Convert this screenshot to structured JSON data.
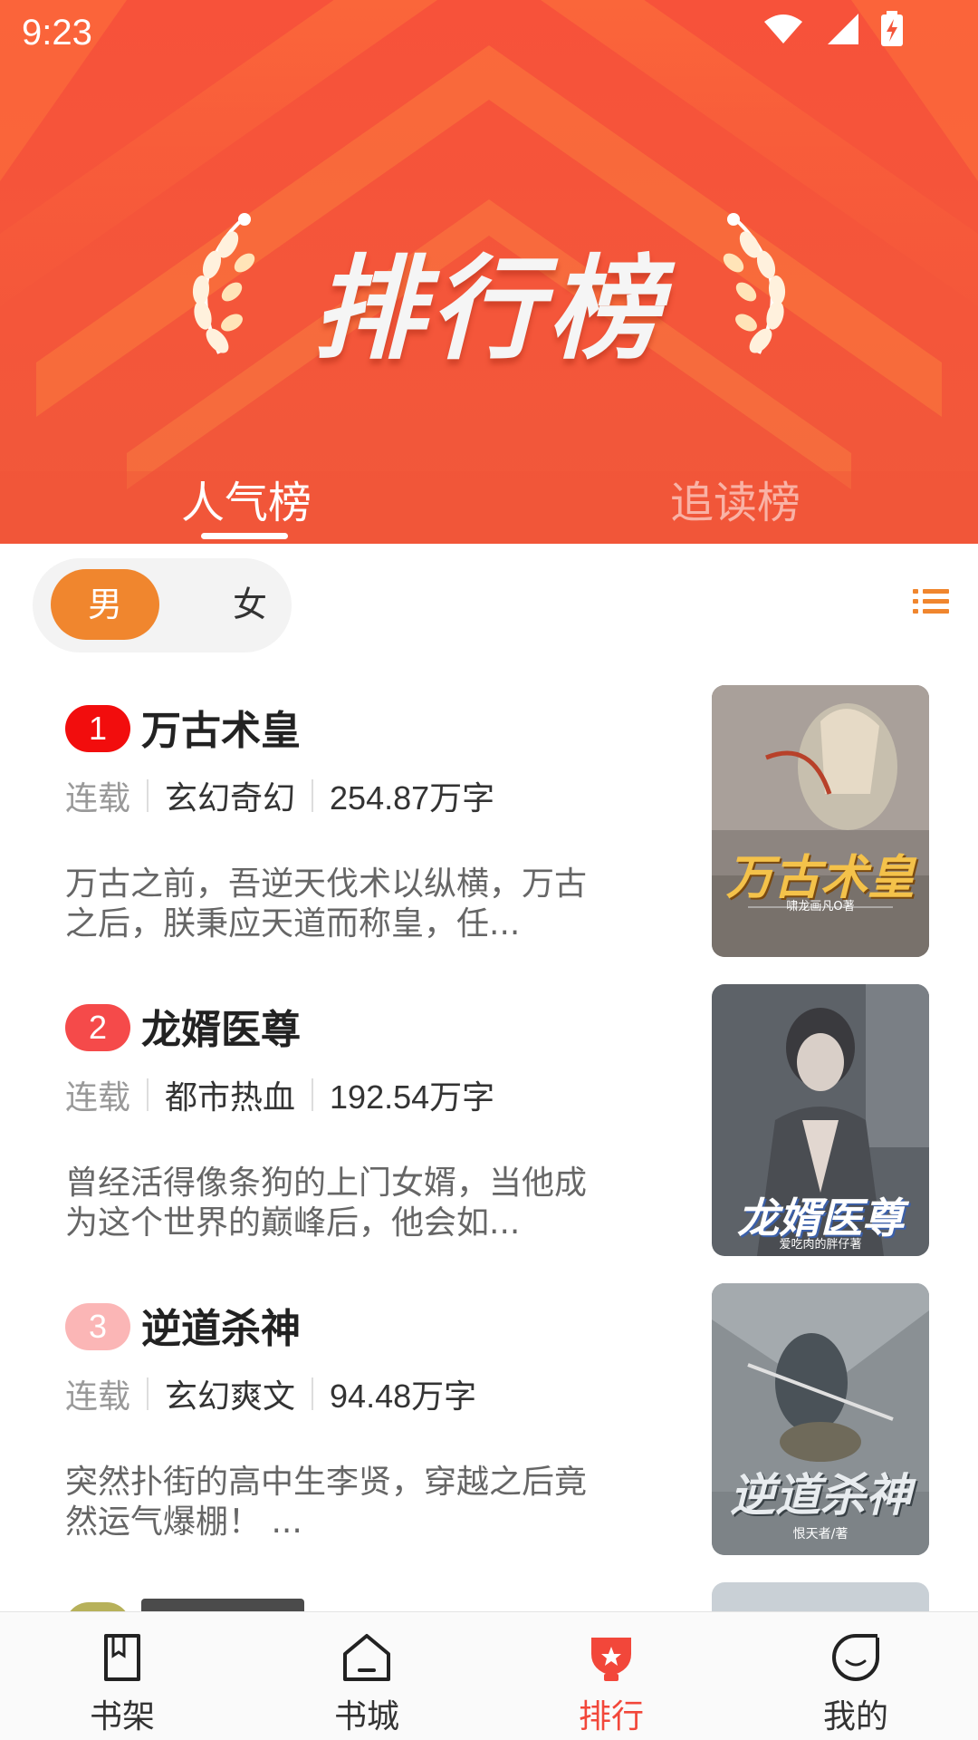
{
  "status_bar": {
    "time": "9:23"
  },
  "banner": {
    "title": "排行榜"
  },
  "top_tabs": [
    {
      "label": "人气榜",
      "active": true
    },
    {
      "label": "追读榜",
      "active": false
    }
  ],
  "gender_toggle": {
    "options": [
      "男",
      "女"
    ],
    "selected": "男"
  },
  "books": [
    {
      "rank": "1",
      "title": "万古术皇",
      "status": "连载",
      "genre": "玄幻奇幻",
      "words": "254.87万字",
      "desc": "万古之前，吾逆天伐术以纵横，万古之后，朕秉应天道而称皇，任...",
      "cover_title": "万古术皇",
      "cover_author": "啸龙画凡O著",
      "rank_color": "#f20d0d"
    },
    {
      "rank": "2",
      "title": "龙婿医尊",
      "status": "连载",
      "genre": "都市热血",
      "words": "192.54万字",
      "desc": "曾经活得像条狗的上门女婿，当他成为这个世界的巅峰后，他会如...",
      "cover_title": "龙婿医尊",
      "cover_author": "爱吃肉的胖仔著",
      "rank_color": "#f54a4a"
    },
    {
      "rank": "3",
      "title": "逆道杀神",
      "status": "连载",
      "genre": "玄幻爽文",
      "words": "94.48万字",
      "desc": "突然扑街的高中生李贤，穿越之后竟然运气爆棚！ ...",
      "cover_title": "逆道杀神",
      "cover_author": "恨天者/著",
      "rank_color": "#fbb6b6"
    }
  ],
  "bottom_nav": [
    {
      "label": "书架",
      "icon": "bookshelf-icon",
      "active": false
    },
    {
      "label": "书城",
      "icon": "store-icon",
      "active": false
    },
    {
      "label": "排行",
      "icon": "trophy-icon",
      "active": true
    },
    {
      "label": "我的",
      "icon": "profile-icon",
      "active": false
    }
  ],
  "colors": {
    "banner": "#f4563a",
    "accent_orange": "#f0862e",
    "active_nav": "#f2473a"
  }
}
